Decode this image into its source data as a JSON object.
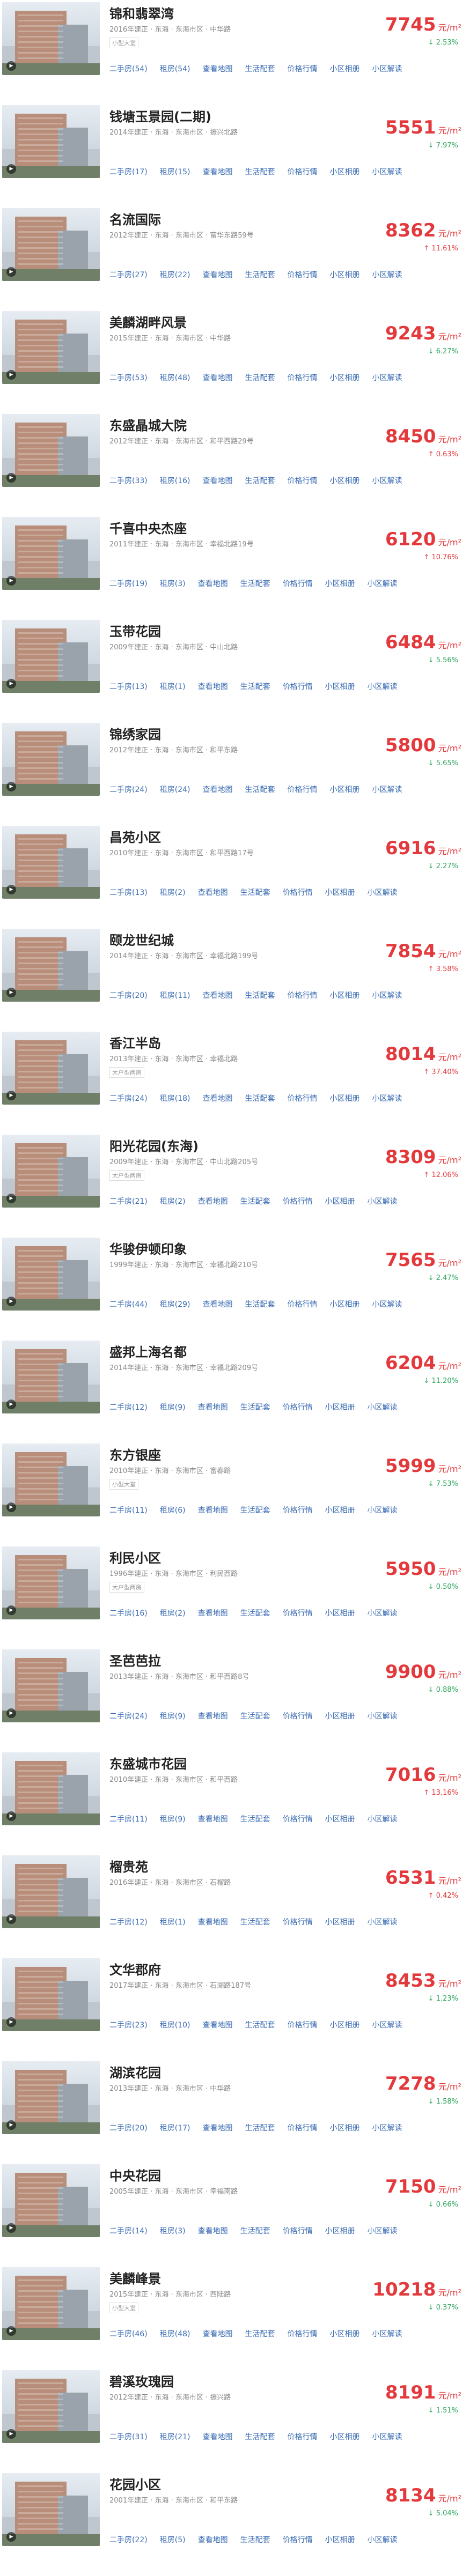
{
  "unit": "元/m²",
  "links": [
    "二手房(54)",
    "租房(54)",
    "查看地图",
    "生活配套",
    "价格行情",
    "小区相册",
    "小区解读"
  ],
  "communities": [
    {
      "name": "锦和翡翠湾",
      "meta": "2016年建正 · 东海 · 东海市区 · 中华路",
      "tag": "小型大室",
      "price": "7745",
      "change": "↓ 2.53%",
      "dir": "down",
      "links": [
        "二手房(54)",
        "租房(54)",
        "查看地图",
        "生活配套",
        "价格行情",
        "小区相册",
        "小区解读"
      ]
    },
    {
      "name": "钱塘玉景园(二期)",
      "meta": "2014年建正 · 东海 · 东海市区 · 振兴北路",
      "tag": "",
      "price": "5551",
      "change": "↓ 7.97%",
      "dir": "down",
      "links": [
        "二手房(17)",
        "租房(15)",
        "查看地图",
        "生活配套",
        "价格行情",
        "小区相册",
        "小区解读"
      ]
    },
    {
      "name": "名流国际",
      "meta": "2012年建正 · 东海 · 东海市区 · 富华东路59号",
      "tag": "",
      "price": "8362",
      "change": "↑ 11.61%",
      "dir": "up",
      "links": [
        "二手房(27)",
        "租房(22)",
        "查看地图",
        "生活配套",
        "价格行情",
        "小区相册",
        "小区解读"
      ]
    },
    {
      "name": "美麟湖畔风景",
      "meta": "2015年建正 · 东海 · 东海市区 · 中华路",
      "tag": "",
      "price": "9243",
      "change": "↓ 6.27%",
      "dir": "down",
      "links": [
        "二手房(53)",
        "租房(48)",
        "查看地图",
        "生活配套",
        "价格行情",
        "小区相册",
        "小区解读"
      ]
    },
    {
      "name": "东盛晶城大院",
      "meta": "2012年建正 · 东海 · 东海市区 · 和平西路29号",
      "tag": "",
      "price": "8450",
      "change": "↑ 0.63%",
      "dir": "up",
      "links": [
        "二手房(33)",
        "租房(16)",
        "查看地图",
        "生活配套",
        "价格行情",
        "小区相册",
        "小区解读"
      ]
    },
    {
      "name": "千喜中央杰座",
      "meta": "2011年建正 · 东海 · 东海市区 · 幸福北路19号",
      "tag": "",
      "price": "6120",
      "change": "↑ 10.76%",
      "dir": "up",
      "links": [
        "二手房(19)",
        "租房(3)",
        "查看地图",
        "生活配套",
        "价格行情",
        "小区相册",
        "小区解读"
      ]
    },
    {
      "name": "玉带花园",
      "meta": "2009年建正 · 东海 · 东海市区 · 中山北路",
      "tag": "",
      "price": "6484",
      "change": "↓ 5.56%",
      "dir": "down",
      "links": [
        "二手房(13)",
        "租房(1)",
        "查看地图",
        "生活配套",
        "价格行情",
        "小区相册",
        "小区解读"
      ]
    },
    {
      "name": "锦绣家园",
      "meta": "2012年建正 · 东海 · 东海市区 · 和平东路",
      "tag": "",
      "price": "5800",
      "change": "↓ 5.65%",
      "dir": "down",
      "links": [
        "二手房(24)",
        "租房(24)",
        "查看地图",
        "生活配套",
        "价格行情",
        "小区相册",
        "小区解读"
      ]
    },
    {
      "name": "昌苑小区",
      "meta": "2010年建正 · 东海 · 东海市区 · 和平西路17号",
      "tag": "",
      "price": "6916",
      "change": "↓ 2.27%",
      "dir": "down",
      "links": [
        "二手房(13)",
        "租房(2)",
        "查看地图",
        "生活配套",
        "价格行情",
        "小区相册",
        "小区解读"
      ]
    },
    {
      "name": "颐龙世纪城",
      "meta": "2014年建正 · 东海 · 东海市区 · 幸福北路199号",
      "tag": "",
      "price": "7854",
      "change": "↑ 3.58%",
      "dir": "up",
      "links": [
        "二手房(20)",
        "租房(11)",
        "查看地图",
        "生活配套",
        "价格行情",
        "小区相册",
        "小区解读"
      ]
    },
    {
      "name": "香江半岛",
      "meta": "2013年建正 · 东海 · 东海市区 · 幸福北路",
      "tag": "大户型两房",
      "price": "8014",
      "change": "↑ 37.40%",
      "dir": "up",
      "links": [
        "二手房(24)",
        "租房(18)",
        "查看地图",
        "生活配套",
        "价格行情",
        "小区相册",
        "小区解读"
      ]
    },
    {
      "name": "阳光花园(东海)",
      "meta": "2009年建正 · 东海 · 东海市区 · 中山北路205号",
      "tag": "大户型两房",
      "price": "8309",
      "change": "↑ 12.06%",
      "dir": "up",
      "links": [
        "二手房(21)",
        "租房(2)",
        "查看地图",
        "生活配套",
        "价格行情",
        "小区相册",
        "小区解读"
      ]
    },
    {
      "name": "华骏伊顿印象",
      "meta": "1999年建正 · 东海 · 东海市区 · 幸福北路210号",
      "tag": "",
      "price": "7565",
      "change": "↓ 2.47%",
      "dir": "down",
      "links": [
        "二手房(44)",
        "租房(29)",
        "查看地图",
        "生活配套",
        "价格行情",
        "小区相册",
        "小区解读"
      ]
    },
    {
      "name": "盛邦上海名都",
      "meta": "2014年建正 · 东海 · 东海市区 · 幸福北路209号",
      "tag": "",
      "price": "6204",
      "change": "↓ 11.20%",
      "dir": "down",
      "links": [
        "二手房(12)",
        "租房(9)",
        "查看地图",
        "生活配套",
        "价格行情",
        "小区相册",
        "小区解读"
      ]
    },
    {
      "name": "东方银座",
      "meta": "2010年建正 · 东海 · 东海市区 · 富春路",
      "tag": "小型大室",
      "price": "5999",
      "change": "↓ 7.53%",
      "dir": "down",
      "links": [
        "二手房(11)",
        "租房(6)",
        "查看地图",
        "生活配套",
        "价格行情",
        "小区相册",
        "小区解读"
      ]
    },
    {
      "name": "利民小区",
      "meta": "1996年建正 · 东海 · 东海市区 · 利民西路",
      "tag": "大户型两房",
      "price": "5950",
      "change": "↓ 0.50%",
      "dir": "down",
      "links": [
        "二手房(16)",
        "租房(2)",
        "查看地图",
        "生活配套",
        "价格行情",
        "小区相册",
        "小区解读"
      ]
    },
    {
      "name": "圣芭芭拉",
      "meta": "2013年建正 · 东海 · 东海市区 · 和平西路8号",
      "tag": "",
      "price": "9900",
      "change": "↓ 0.88%",
      "dir": "down",
      "links": [
        "二手房(24)",
        "租房(9)",
        "查看地图",
        "生活配套",
        "价格行情",
        "小区相册",
        "小区解读"
      ]
    },
    {
      "name": "东盛城市花园",
      "meta": "2010年建正 · 东海 · 东海市区 · 和平西路",
      "tag": "",
      "price": "7016",
      "change": "↑ 13.16%",
      "dir": "up",
      "links": [
        "二手房(11)",
        "租房(9)",
        "查看地图",
        "生活配套",
        "价格行情",
        "小区相册",
        "小区解读"
      ]
    },
    {
      "name": "榴贵苑",
      "meta": "2016年建正 · 东海 · 东海市区 · 石榴路",
      "tag": "",
      "price": "6531",
      "change": "↑ 0.42%",
      "dir": "up",
      "links": [
        "二手房(12)",
        "租房(1)",
        "查看地图",
        "生活配套",
        "价格行情",
        "小区相册",
        "小区解读"
      ]
    },
    {
      "name": "文华郡府",
      "meta": "2017年建正 · 东海 · 东海市区 · 石湖路187号",
      "tag": "",
      "price": "8453",
      "change": "↓ 1.23%",
      "dir": "down",
      "links": [
        "二手房(23)",
        "租房(10)",
        "查看地图",
        "生活配套",
        "价格行情",
        "小区相册",
        "小区解读"
      ]
    },
    {
      "name": "湖滨花园",
      "meta": "2013年建正 · 东海 · 东海市区 · 中华路",
      "tag": "",
      "price": "7278",
      "change": "↓ 1.58%",
      "dir": "down",
      "links": [
        "二手房(20)",
        "租房(17)",
        "查看地图",
        "生活配套",
        "价格行情",
        "小区相册",
        "小区解读"
      ]
    },
    {
      "name": "中央花园",
      "meta": "2005年建正 · 东海 · 东海市区 · 幸福南路",
      "tag": "",
      "price": "7150",
      "change": "↓ 0.66%",
      "dir": "down",
      "links": [
        "二手房(14)",
        "租房(3)",
        "查看地图",
        "生活配套",
        "价格行情",
        "小区相册",
        "小区解读"
      ]
    },
    {
      "name": "美麟峰景",
      "meta": "2015年建正 · 东海 · 东海市区 · 西陆路",
      "tag": "小型大室",
      "price": "10218",
      "change": "↓ 0.37%",
      "dir": "down",
      "links": [
        "二手房(46)",
        "租房(48)",
        "查看地图",
        "生活配套",
        "价格行情",
        "小区相册",
        "小区解读"
      ]
    },
    {
      "name": "碧溪玫瑰园",
      "meta": "2012年建正 · 东海 · 东海市区 · 振兴路",
      "tag": "",
      "price": "8191",
      "change": "↓ 1.51%",
      "dir": "down",
      "links": [
        "二手房(31)",
        "租房(21)",
        "查看地图",
        "生活配套",
        "价格行情",
        "小区相册",
        "小区解读"
      ]
    },
    {
      "name": "花园小区",
      "meta": "2001年建正 · 东海 · 东海市区 · 和平东路",
      "tag": "",
      "price": "8134",
      "change": "↓ 5.04%",
      "dir": "down",
      "links": [
        "二手房(22)",
        "租房(5)",
        "查看地图",
        "生活配套",
        "价格行情",
        "小区相册",
        "小区解读"
      ]
    }
  ]
}
